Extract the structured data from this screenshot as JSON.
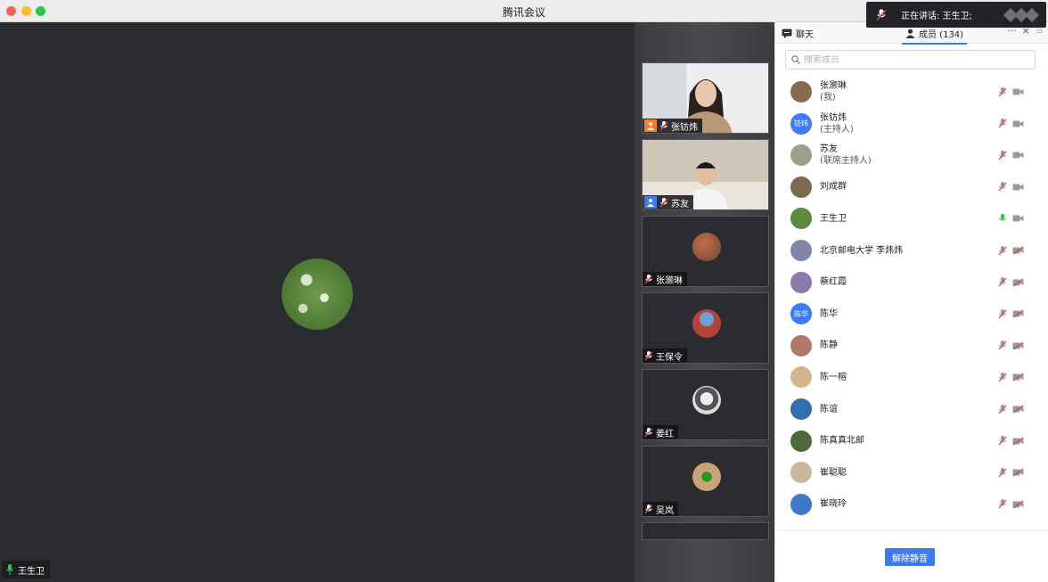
{
  "window": {
    "title": "腾讯会议"
  },
  "stage": {
    "active_speaker": "王生卫"
  },
  "strip": {
    "tiles": [
      {
        "name": "张钫炜"
      },
      {
        "name": "苏友"
      },
      {
        "name": "张灏琳"
      },
      {
        "name": "王保令"
      },
      {
        "name": "姜红"
      },
      {
        "name": "吴岚"
      }
    ]
  },
  "panel": {
    "tab_chat": "聊天",
    "tab_members": "成员 (134)",
    "more": "···",
    "close": "×",
    "menu": "≡",
    "search_placeholder": "搜索成员",
    "members": [
      {
        "name": "张灏琳",
        "role": "(我)",
        "avatar_color": "#8a6a4e",
        "avatar_text": ""
      },
      {
        "name": "张钫炜",
        "role": "(主持人)",
        "avatar_color": "#3d7bf5",
        "avatar_text": "钫炜"
      },
      {
        "name": "苏友",
        "role": "(联席主持人)",
        "avatar_color": "#9aa08a",
        "avatar_text": ""
      },
      {
        "name": "刘成群",
        "role": "",
        "avatar_color": "#7b6a4f",
        "avatar_text": ""
      },
      {
        "name": "王生卫",
        "role": "",
        "avatar_color": "#5d8a3c",
        "avatar_text": ""
      },
      {
        "name": "北京邮电大学 李炜炜",
        "role": "",
        "avatar_color": "#7f86a8",
        "avatar_text": ""
      },
      {
        "name": "蔡红霞",
        "role": "",
        "avatar_color": "#8a7ab0",
        "avatar_text": ""
      },
      {
        "name": "陈华",
        "role": "",
        "avatar_color": "#3d7bf5",
        "avatar_text": "陈华"
      },
      {
        "name": "陈静",
        "role": "",
        "avatar_color": "#b07a6a",
        "avatar_text": ""
      },
      {
        "name": "陈一榕",
        "role": "",
        "avatar_color": "#d4b48a",
        "avatar_text": ""
      },
      {
        "name": "陈谊",
        "role": "",
        "avatar_color": "#2f6fb0",
        "avatar_text": ""
      },
      {
        "name": "陈真真北邮",
        "role": "",
        "avatar_color": "#4e6a3a",
        "avatar_text": ""
      },
      {
        "name": "崔聪聪",
        "role": "",
        "avatar_color": "#c9b89a",
        "avatar_text": ""
      },
      {
        "name": "崔晓玲",
        "role": "",
        "avatar_color": "#3f78c8",
        "avatar_text": ""
      }
    ],
    "unmute_all": "解除静音"
  },
  "toast": {
    "text": "正在讲话: 王生卫;"
  },
  "colors": {
    "accent": "#3d7bf5",
    "mic_active": "#35c24a",
    "mic_muted": "#d0444a"
  }
}
